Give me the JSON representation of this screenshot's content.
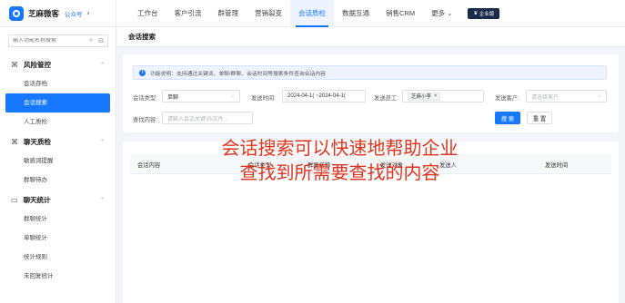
{
  "brand": {
    "name": "芝麻微客",
    "badge": "公众号"
  },
  "nav": {
    "items": [
      "工作台",
      "客户引流",
      "群管理",
      "营销裂变",
      "会话质检",
      "数据互通",
      "销售CRM"
    ],
    "active_index": 4,
    "more": "更多",
    "enterprise": "企业版"
  },
  "sidebar": {
    "search_placeholder": "输入功能名称搜索",
    "groups": [
      {
        "label": "风险管控",
        "items": [
          "会话存档",
          "会话搜索",
          "人工质检"
        ]
      },
      {
        "label": "聊天质检",
        "items": [
          "敏感词提醒",
          "群聊待办"
        ]
      },
      {
        "label": "聊天统计",
        "items": [
          "群聊统计",
          "单聊统计",
          "统计规则",
          "未回复统计"
        ]
      }
    ],
    "active_item": "会话搜索"
  },
  "page": {
    "title": "会话搜索"
  },
  "filters": {
    "tip": "功能说明：支持通过关键词、单聊/群聊、会话时间等搜索条件查询会话内容",
    "session_type_label": "会话类型:",
    "session_type_value": "单聊",
    "send_time_label": "发送时间:",
    "send_time_value": "2024-04-1( ~2024-04-1(",
    "sender_label": "发送员工:",
    "sender_tag": "芝麻小李",
    "customer_label": "发送客户:",
    "customer_placeholder": "请选择客户",
    "content_label": "查找内容:",
    "content_placeholder": "请输入会话关键词/文件...",
    "search_button": "搜 索",
    "reset_button": "重 置"
  },
  "table": {
    "columns": [
      "会话内容",
      "会话类型",
      "群聊名称",
      "发送对象",
      "发送人",
      "发送时间"
    ]
  },
  "overlay": {
    "line1": "会话搜索可以快速地帮助企业",
    "line2": "查找到所需要查找的内容"
  },
  "colors": {
    "accent": "#1677ff",
    "overlay_text": "#e0341e"
  }
}
